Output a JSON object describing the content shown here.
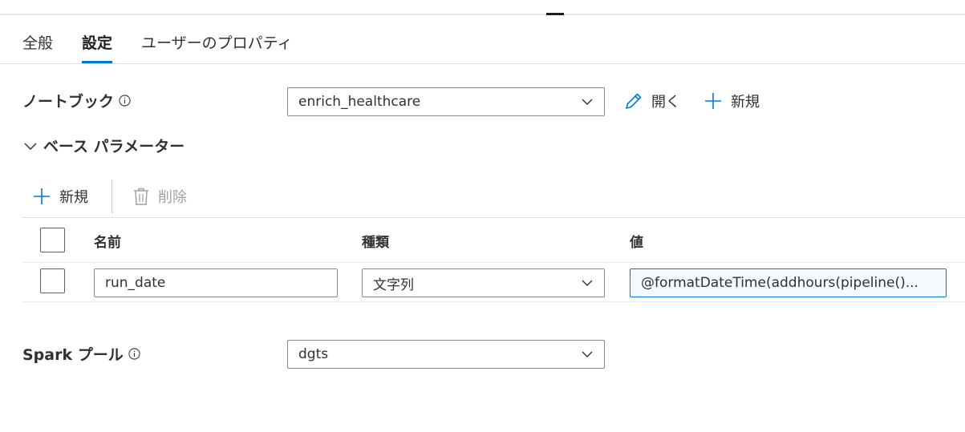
{
  "tabs": [
    {
      "label": "全般",
      "active": false
    },
    {
      "label": "設定",
      "active": true
    },
    {
      "label": "ユーザーのプロパティ",
      "active": false
    }
  ],
  "notebook": {
    "label": "ノートブック",
    "selected": "enrich_healthcare",
    "open_label": "開く",
    "new_label": "新規"
  },
  "base_params": {
    "section_title": "ベース パラメーター",
    "new_label": "新規",
    "delete_label": "削除",
    "columns": [
      "名前",
      "種類",
      "値"
    ],
    "rows": [
      {
        "name": "run_date",
        "type": "文字列",
        "value": "@formatDateTime(addhours(pipeline()..."
      }
    ]
  },
  "spark_pool": {
    "label": "Spark プール",
    "selected": "dgts"
  },
  "colors": {
    "accent": "#0078d4",
    "text": "#323130",
    "disabled": "#a19f9d"
  }
}
